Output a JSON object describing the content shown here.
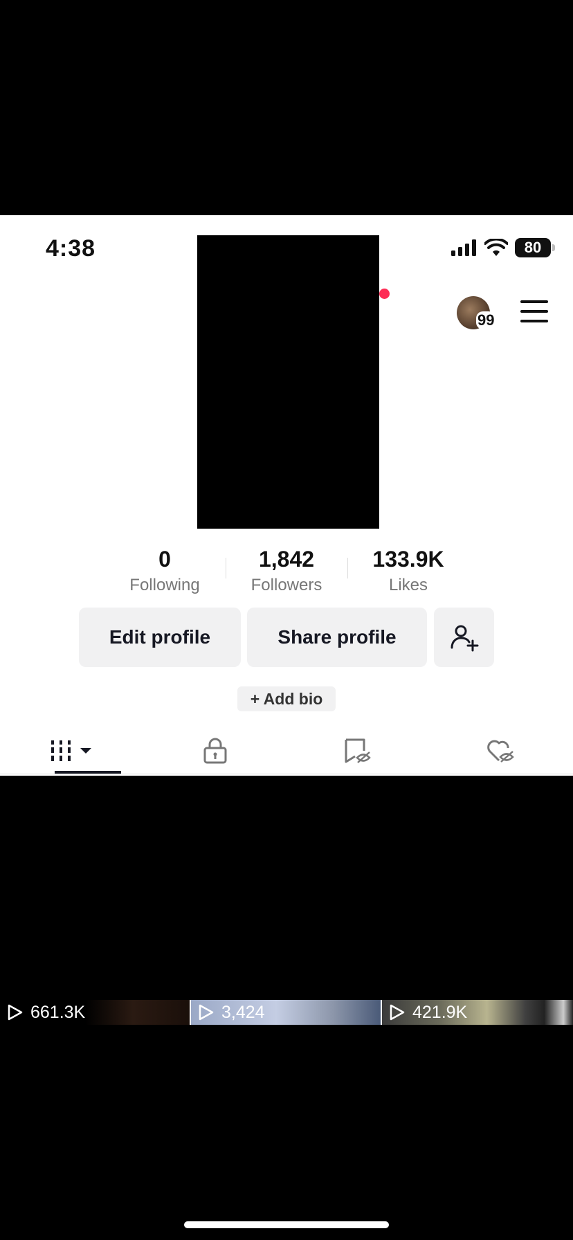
{
  "status_bar": {
    "time": "4:38",
    "battery": "80"
  },
  "profile": {
    "notification_badge": "99"
  },
  "stats": [
    {
      "value": "0",
      "label": "Following"
    },
    {
      "value": "1,842",
      "label": "Followers"
    },
    {
      "value": "133.9K",
      "label": "Likes"
    }
  ],
  "actions": {
    "edit_profile": "Edit profile",
    "share_profile": "Share profile",
    "add_bio": "+ Add bio"
  },
  "tabs": [
    {
      "icon": "videos-grid-icon",
      "active": true
    },
    {
      "icon": "lock-icon",
      "active": false
    },
    {
      "icon": "hidden-bookmark-icon",
      "active": false
    },
    {
      "icon": "hidden-liked-icon",
      "active": false
    }
  ],
  "videos": [
    {
      "views": "661.3K"
    },
    {
      "views": "3,424"
    },
    {
      "views": "421.9K"
    }
  ],
  "colors": {
    "accent_dot": "#fe2c55",
    "button_bg": "#f1f1f2",
    "text_primary": "#161823",
    "text_secondary": "#777777"
  }
}
